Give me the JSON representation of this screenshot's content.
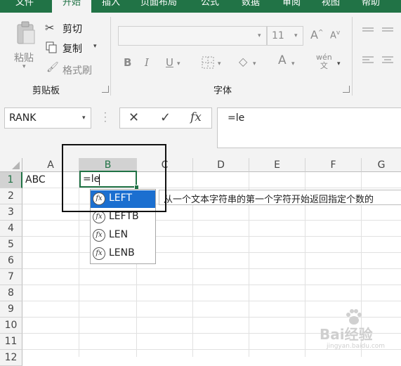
{
  "tabs": [
    {
      "label": "文件",
      "active": false
    },
    {
      "label": "开始",
      "active": true
    },
    {
      "label": "插入",
      "active": false
    },
    {
      "label": "页面布局",
      "active": false
    },
    {
      "label": "公式",
      "active": false
    },
    {
      "label": "数据",
      "active": false
    },
    {
      "label": "审阅",
      "active": false
    },
    {
      "label": "视图",
      "active": false
    },
    {
      "label": "帮助",
      "active": false
    }
  ],
  "ribbon": {
    "clipboard": {
      "paste": "粘贴",
      "cut": "剪切",
      "copy": "复制",
      "format_painter": "格式刷",
      "group": "剪贴板"
    },
    "font": {
      "family": "",
      "size": "11",
      "group": "字体"
    }
  },
  "formula_bar": {
    "name_box": "RANK",
    "cancel_icon": "close-icon",
    "enter_icon": "check-icon",
    "fx": "fx",
    "formula": "=le"
  },
  "grid": {
    "columns": [
      "A",
      "B",
      "C",
      "D",
      "E",
      "F",
      "G"
    ],
    "selected_column": "B",
    "rows": [
      "1",
      "2",
      "3",
      "4",
      "5",
      "6",
      "7",
      "8",
      "9",
      "10",
      "11",
      "12"
    ],
    "selected_row": "1",
    "cells": {
      "A1": "ABC",
      "B1": "=le"
    }
  },
  "autocomplete": {
    "items": [
      "LEFT",
      "LEFTB",
      "LEN",
      "LENB"
    ],
    "selected": "LEFT",
    "tooltip": "从一个文本字符串的第一个字符开始返回指定个数的"
  },
  "watermark": {
    "text": "Bai经验",
    "sub": "jingyan.baidu.com"
  },
  "colors": {
    "excel_green": "#217346",
    "selection_blue": "#1b6fd0"
  }
}
